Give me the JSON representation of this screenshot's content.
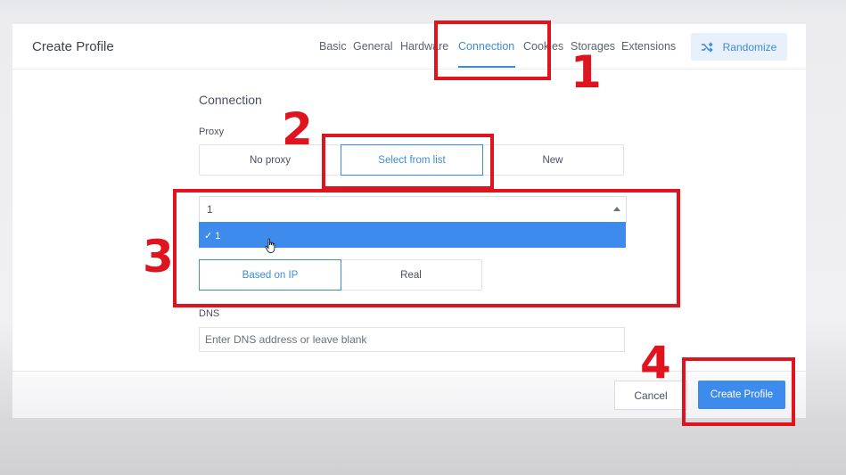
{
  "dialog": {
    "title": "Create Profile",
    "tabs": [
      {
        "label": "Basic"
      },
      {
        "label": "General"
      },
      {
        "label": "Hardware"
      },
      {
        "label": "Connection",
        "active": true
      },
      {
        "label": "Cookies"
      },
      {
        "label": "Storages"
      },
      {
        "label": "Extensions"
      }
    ],
    "randomize_label": "Randomize"
  },
  "connection": {
    "section_title": "Connection",
    "proxy": {
      "label": "Proxy",
      "options": [
        "No proxy",
        "Select from list",
        "New"
      ],
      "selected": "Select from list"
    },
    "proxy_select": {
      "value": "1",
      "highlighted_option": "✓ 1"
    },
    "location": {
      "options": [
        "Based on IP",
        "Real"
      ],
      "selected": "Based on IP"
    },
    "dns": {
      "label": "DNS",
      "placeholder": "Enter DNS address or leave blank",
      "value": ""
    }
  },
  "footer": {
    "cancel_label": "Cancel",
    "create_label": "Create Profile"
  },
  "annotations": {
    "color": "#e0141e",
    "numbers": [
      "1",
      "2",
      "3",
      "4"
    ]
  },
  "colors": {
    "accent": "#3d8bd9",
    "primary_button": "#3d8bec",
    "highlight_option": "#3d8bec"
  }
}
